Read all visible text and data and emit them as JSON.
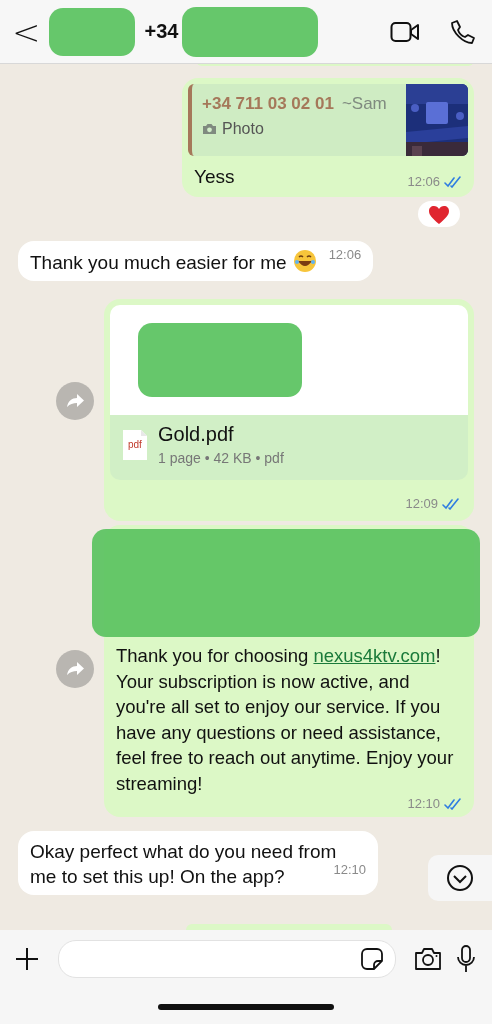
{
  "header": {
    "back_label": "<",
    "phone_prefix": "+34"
  },
  "messages": [
    {
      "kind": "quote",
      "outgoing": true,
      "quote": {
        "author": "+34 711 03 02 01",
        "sender": "~Sam",
        "media": "Photo"
      },
      "text": "Yess",
      "time": "12:06",
      "read": true,
      "heart_reaction": true,
      "forward_button": false
    },
    {
      "kind": "text",
      "outgoing": false,
      "text": "Thank you much easier for me",
      "time": "12:06",
      "forward_button": false
    },
    {
      "kind": "document",
      "outgoing": true,
      "file": {
        "name": "Gold.pdf",
        "type": "pdf",
        "meta": "1 page • 42 KB • pdf"
      },
      "time": "12:09",
      "read": true,
      "forward_button": true
    },
    {
      "kind": "media_text",
      "outgoing": true,
      "text_parts": [
        {
          "kind": "plain",
          "text": "Thank you for choosing "
        },
        {
          "kind": "link",
          "text": "nexus4ktv.com"
        },
        {
          "kind": "plain",
          "text": "! Your subscription is now active, and you're all set to enjoy our service. If you have any questions or need assistance, feel free to reach out anytime. Enjoy your streaming!"
        }
      ],
      "time": "12:10",
      "read": true,
      "forward_button": true
    },
    {
      "kind": "text",
      "outgoing": false,
      "text": "Okay perfect what do you need from me to set this up! On the app?",
      "time": "12:10",
      "forward_button": false
    }
  ]
}
